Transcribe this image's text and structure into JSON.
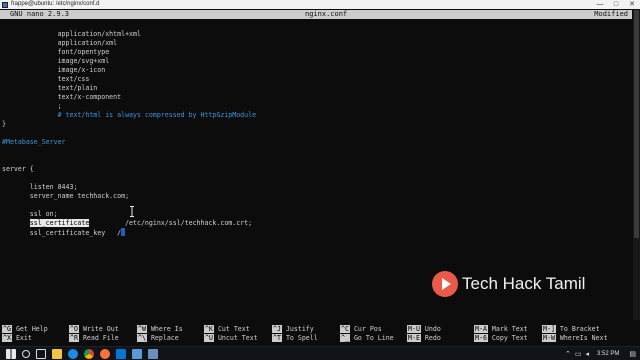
{
  "window": {
    "title": "frappe@ubuntu: /etc/nginx/conf.d",
    "controls": [
      "—",
      "□",
      "✕"
    ]
  },
  "nano_header": {
    "version": "GNU nano 2.9.3",
    "filename": "nginx.conf",
    "status": "Modified"
  },
  "editor": {
    "lines": [
      "              application/xhtml+xml",
      "              application/xml",
      "              font/opentype",
      "              image/svg+xml",
      "              image/x-icon",
      "              text/css",
      "              text/plain",
      "              text/x-component",
      "              ;",
      "              # text/html is always compressed by HttpGzipModule",
      "}",
      "#Metabase_Server",
      "server {",
      "       listen 8443;",
      "       server_name techhack.com;",
      "       ssl on;",
      "       ssl_certificate",
      "       ssl_certificate_key"
    ],
    "cert_path": "/etc/nginx/ssl/techhack.com.crt;",
    "key_path": "/"
  },
  "shortcuts": [
    {
      "key": "^G",
      "label": "Get Help"
    },
    {
      "key": "^X",
      "label": "Exit"
    },
    {
      "key": "^O",
      "label": "Write Out"
    },
    {
      "key": "^R",
      "label": "Read File"
    },
    {
      "key": "^W",
      "label": "Where Is"
    },
    {
      "key": "^\\",
      "label": "Replace"
    },
    {
      "key": "^K",
      "label": "Cut Text"
    },
    {
      "key": "^U",
      "label": "Uncut Text"
    },
    {
      "key": "^J",
      "label": "Justify"
    },
    {
      "key": "^T",
      "label": "To Spell"
    },
    {
      "key": "^C",
      "label": "Cur Pos"
    },
    {
      "key": "^_",
      "label": "Go To Line"
    },
    {
      "key": "M-U",
      "label": "Undo"
    },
    {
      "key": "M-E",
      "label": "Redo"
    },
    {
      "key": "M-A",
      "label": "Mark Text"
    },
    {
      "key": "M-6",
      "label": "Copy Text"
    },
    {
      "key": "M-]",
      "label": "To Bracket"
    },
    {
      "key": "M-W",
      "label": "WhereIs Next"
    }
  ],
  "watermark": {
    "text": "Tech Hack Tamil"
  },
  "taskbar": {
    "time": "3:52 PM"
  }
}
